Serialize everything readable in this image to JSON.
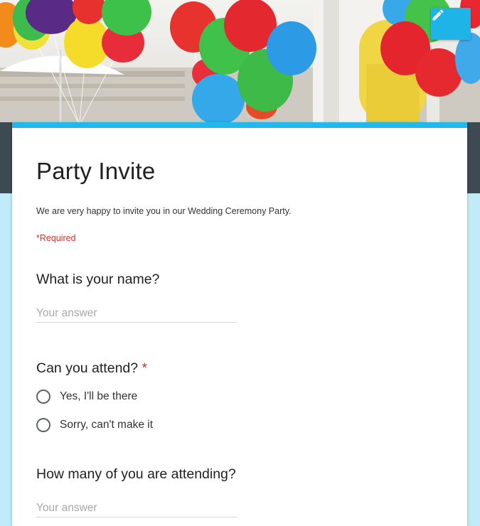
{
  "form": {
    "title": "Party Invite",
    "description": "We are very happy to invite you in our Wedding Ceremony Party.",
    "required_note": "*Required"
  },
  "questions": [
    {
      "label": "What is your name?",
      "type": "short-answer",
      "placeholder": "Your answer",
      "required": false
    },
    {
      "label": "Can you attend?",
      "type": "radio",
      "required": true,
      "required_mark": "*",
      "options": [
        "Yes, I'll be there",
        "Sorry, can't make it"
      ]
    },
    {
      "label": "How many of you are attending?",
      "type": "short-answer",
      "placeholder": "Your answer",
      "required": false
    }
  ],
  "header": {
    "image": "balloons-photo",
    "edit_icon": "pencil-icon"
  },
  "colors": {
    "accent": "#22b8ec",
    "edit_button": "#1fb4e8",
    "page_background": "#c2ebfa",
    "required": "#d93025"
  }
}
